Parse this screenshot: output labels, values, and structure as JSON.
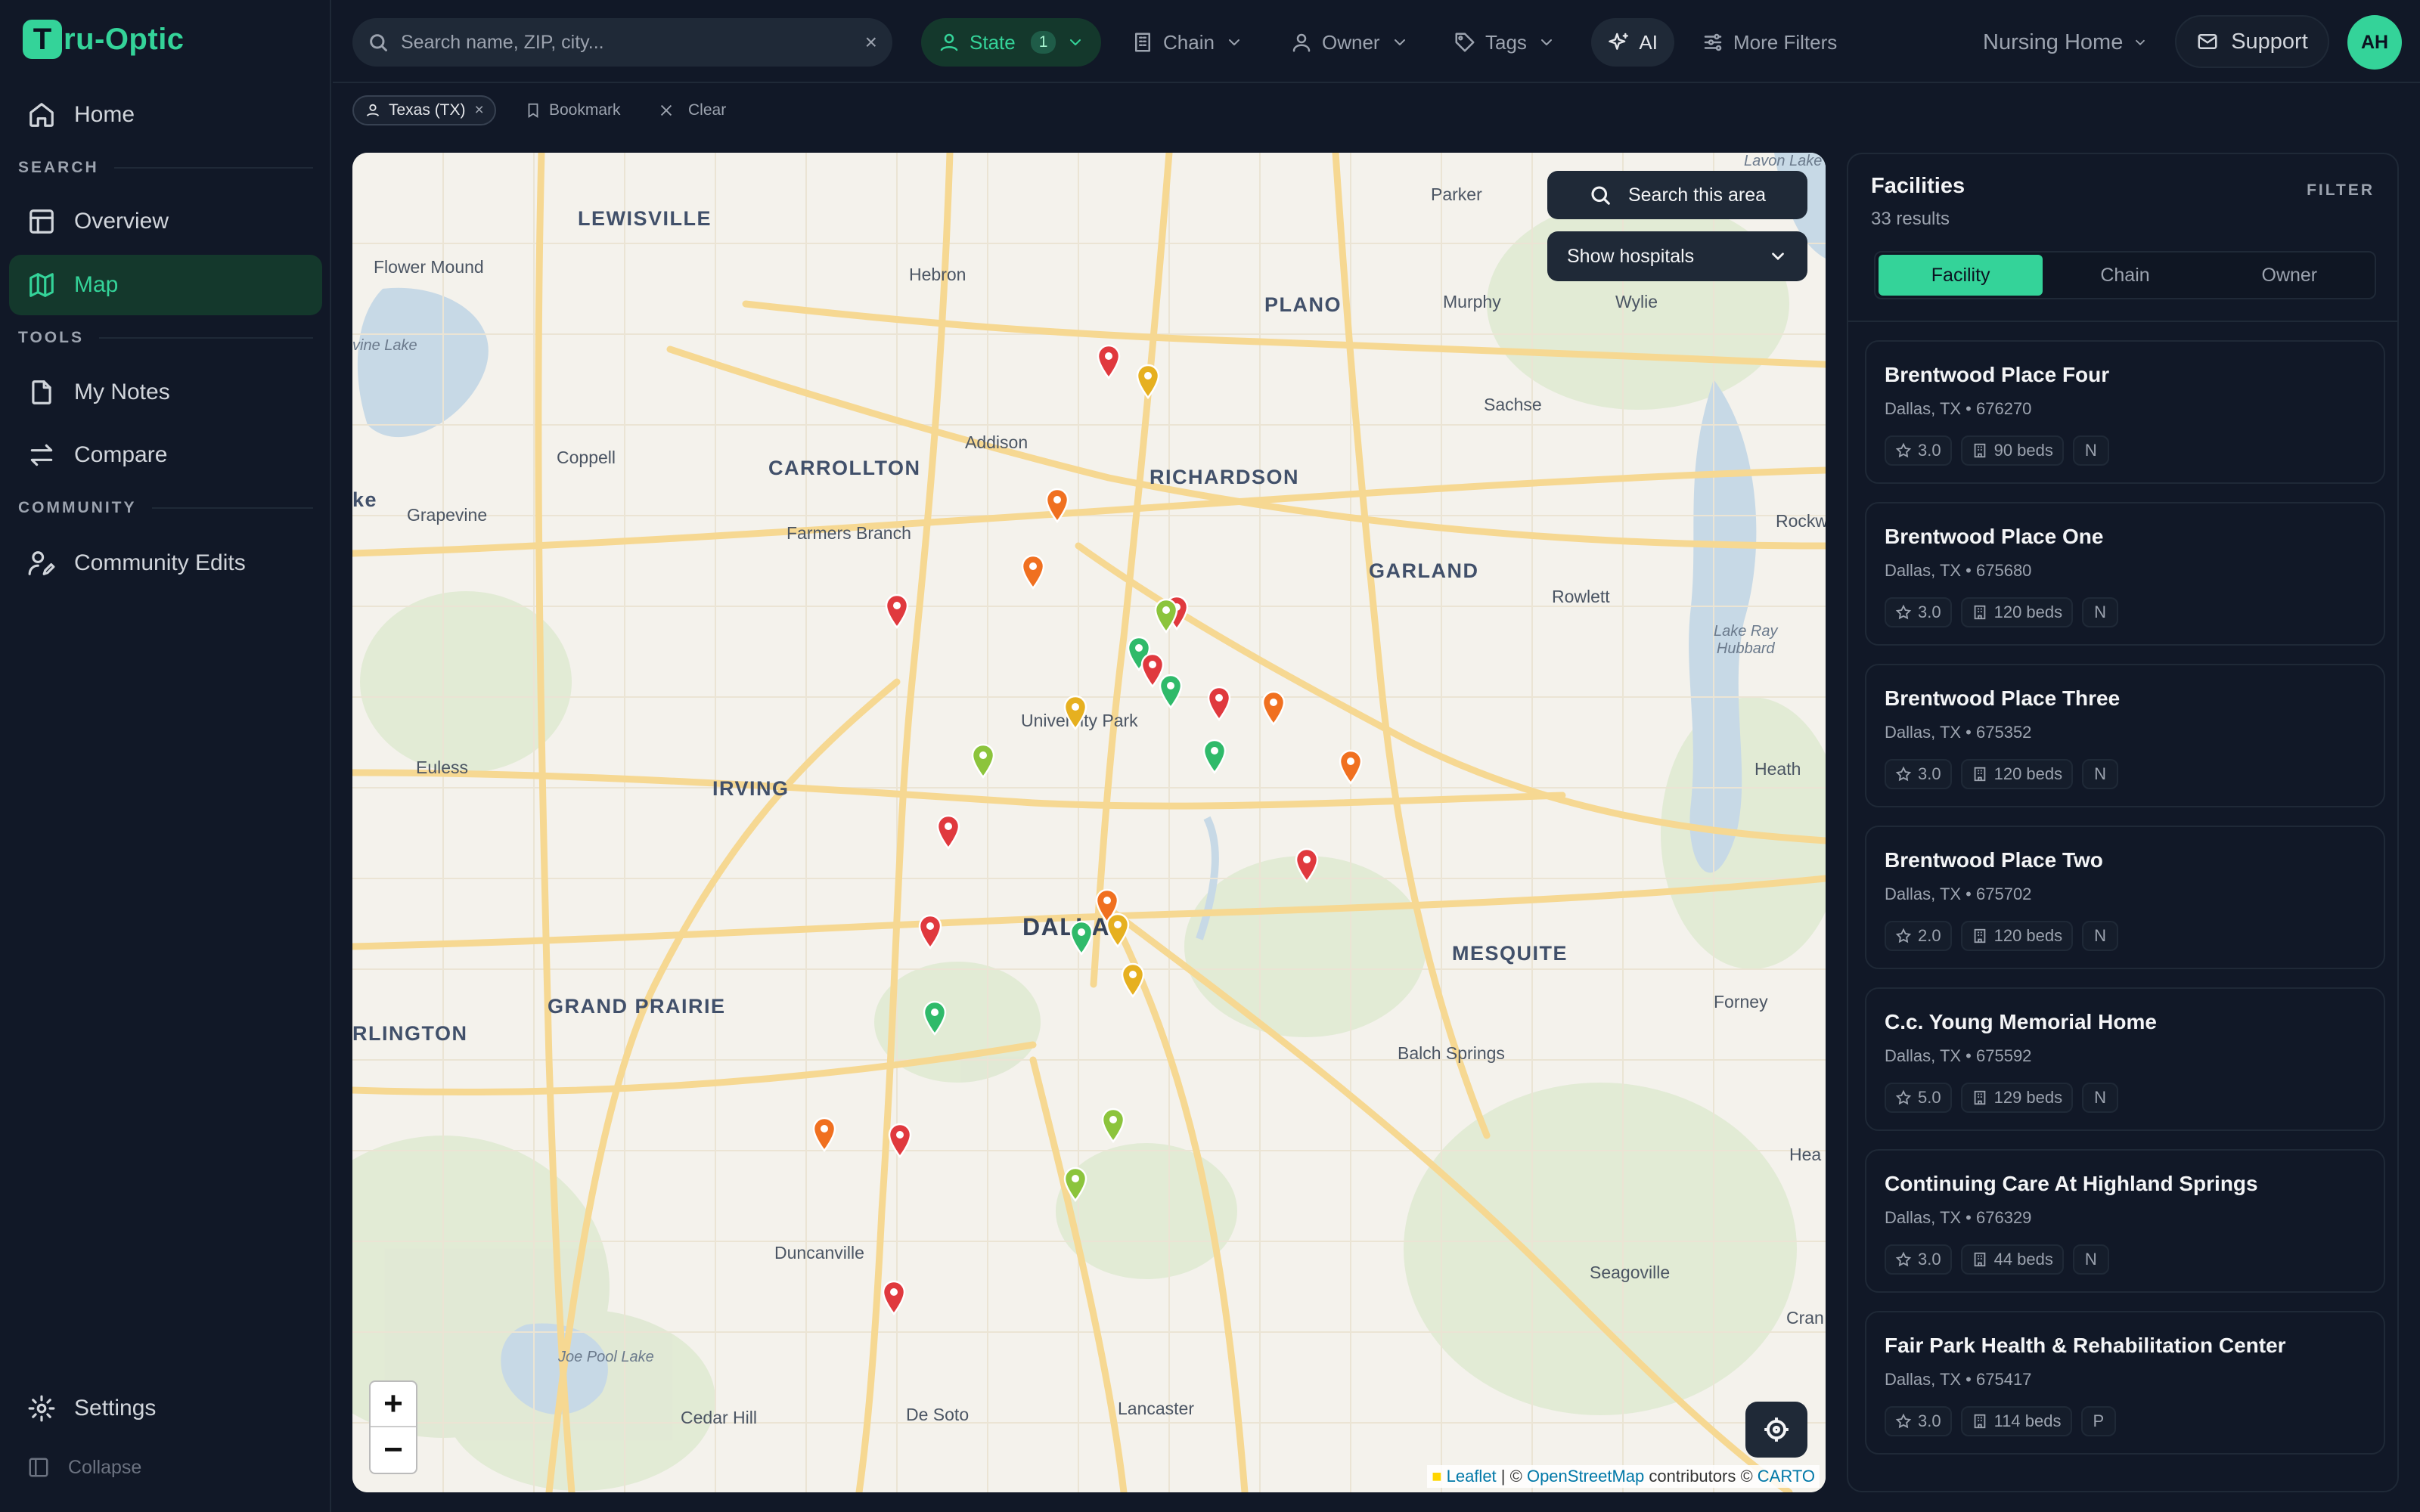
{
  "app": {
    "logo_letter": "T",
    "logo_rest": "ru-Optic"
  },
  "sidebar": {
    "home": "Home",
    "section_search": "SEARCH",
    "overview": "Overview",
    "map": "Map",
    "section_tools": "TOOLS",
    "notes": "My Notes",
    "compare": "Compare",
    "section_community": "COMMUNITY",
    "community_edits": "Community Edits",
    "settings": "Settings",
    "collapse": "Collapse"
  },
  "topbar": {
    "search_placeholder": "Search name, ZIP, city...",
    "state_label": "State",
    "state_count": "1",
    "chain_label": "Chain",
    "owner_label": "Owner",
    "tags_label": "Tags",
    "ai_label": "AI",
    "more_filters": "More Filters",
    "facility_type": "Nursing Home",
    "support": "Support",
    "avatar_initials": "AH"
  },
  "chips": {
    "state_chip": "Texas (TX)",
    "bookmark": "Bookmark",
    "clear": "Clear"
  },
  "map": {
    "search_area": "Search this area",
    "show_hospitals": "Show hospitals",
    "zoom_in": "+",
    "zoom_out": "−",
    "attribution_leaflet": "Leaflet",
    "attribution_osm": "OpenStreetMap",
    "attribution_mid": " contributors © ",
    "attribution_carto": "CARTO",
    "places": {
      "lewisville": "LEWISVILLE",
      "flower_mound": "Flower Mound",
      "hebron": "Hebron",
      "parker": "Parker",
      "lavon_lake": "Lavon Lake",
      "plano": "PLANO",
      "murphy": "Murphy",
      "wylie": "Wylie",
      "sachse": "Sachse",
      "grapevine_lake": "vine Lake",
      "coppell": "Coppell",
      "carrollton": "CARROLLTON",
      "addison": "Addison",
      "richardson": "RICHARDSON",
      "grapevine": "Grapevine",
      "farmers_branch": "Farmers Branch",
      "ke": "ke",
      "rockwall": "Rockw",
      "garland": "GARLAND",
      "rowlett": "Rowlett",
      "lake_ray": "Lake Ray\nHubbard",
      "university_park": "University Park",
      "euless": "Euless",
      "irving": "IRVING",
      "heath": "Heath",
      "dallas": "DALLAS",
      "mesquite": "MESQUITE",
      "grand_prairie": "GRAND PRAIRIE",
      "arlington": "RLINGTON",
      "forney": "Forney",
      "balch_springs": "Balch Springs",
      "hea": "Hea",
      "duncanville": "Duncanville",
      "seagoville": "Seagoville",
      "cran": "Cran",
      "joe_pool_lake": "Joe Pool Lake",
      "cedar_hill": "Cedar Hill",
      "de_soto": "De Soto",
      "lancaster": "Lancaster"
    },
    "marker_colors": {
      "red": "#e0393e",
      "orange": "#f07020",
      "yellow": "#e6b020",
      "lime": "#8cc43c",
      "green": "#2fba6a"
    }
  },
  "panel": {
    "title": "Facilities",
    "results": "33 results",
    "filter": "FILTER",
    "tabs": [
      "Facility",
      "Chain",
      "Owner"
    ],
    "facilities": [
      {
        "name": "Brentwood Place Four",
        "location": "Dallas, TX • 676270",
        "rating": "3.0",
        "beds": "90 beds",
        "type": "N"
      },
      {
        "name": "Brentwood Place One",
        "location": "Dallas, TX • 675680",
        "rating": "3.0",
        "beds": "120 beds",
        "type": "N"
      },
      {
        "name": "Brentwood Place Three",
        "location": "Dallas, TX • 675352",
        "rating": "3.0",
        "beds": "120 beds",
        "type": "N"
      },
      {
        "name": "Brentwood Place Two",
        "location": "Dallas, TX • 675702",
        "rating": "2.0",
        "beds": "120 beds",
        "type": "N"
      },
      {
        "name": "C.c. Young Memorial Home",
        "location": "Dallas, TX • 675592",
        "rating": "5.0",
        "beds": "129 beds",
        "type": "N"
      },
      {
        "name": "Continuing Care At Highland Springs",
        "location": "Dallas, TX • 676329",
        "rating": "3.0",
        "beds": "44 beds",
        "type": "N"
      },
      {
        "name": "Fair Park Health & Rehabilitation Center",
        "location": "Dallas, TX • 675417",
        "rating": "3.0",
        "beds": "114 beds",
        "type": "P"
      }
    ]
  }
}
